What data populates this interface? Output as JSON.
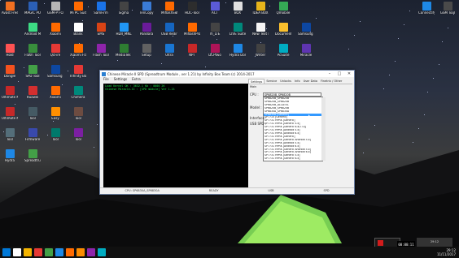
{
  "desktop": {
    "icons": [
      {
        "label": "Avast Free Antivirus",
        "color": "#f37021"
      },
      {
        "label": "MAGIC POK",
        "color": "#2b5fb5"
      },
      {
        "label": "GSM-P FOA",
        "color": "#b6b6b6"
      },
      {
        "label": "Mi PC Suite",
        "color": "#ff6a00"
      },
      {
        "label": "SamFirm",
        "color": "#1a73e8"
      },
      {
        "label": "Sigma",
        "color": "#444444"
      },
      {
        "label": "TenCopy",
        "color": "#3a7bd5"
      },
      {
        "label": "MiflashSetup",
        "color": "#ff6a00"
      },
      {
        "label": "HDC-Tool",
        "color": "#2d2d2d"
      },
      {
        "label": "ACT",
        "color": "#5b5bd6"
      },
      {
        "label": "BOX",
        "color": "#e0e0e0"
      },
      {
        "label": "IDEA BOX",
        "color": "#e7b41b"
      },
      {
        "label": "Qmobile",
        "color": "#35a855"
      },
      {
        "label": "GSM Tool",
        "color": "#4a4a4a"
      },
      {
        "label": "Connectify Hotspot",
        "color": "#1e88e5"
      },
      {
        "label": "Android MTK",
        "color": "#3ddc84"
      },
      {
        "label": "Xiaomi",
        "color": "#ff6a00"
      },
      {
        "label": "Blank",
        "color": "#ffffff"
      },
      {
        "label": "EMS",
        "color": "#d84315"
      },
      {
        "label": "HDII_MNL",
        "color": "#2196f3"
      },
      {
        "label": "Pandora",
        "color": "#6a1b9a"
      },
      {
        "label": "USB Redirect",
        "color": "#1565c0"
      },
      {
        "label": "MiflashPro",
        "color": "#ff6a00"
      },
      {
        "label": "rh_LTE",
        "color": "#444444"
      },
      {
        "label": "LIVE Suite",
        "color": "#00897b"
      },
      {
        "label": "New Text Document",
        "color": "#f5f5f5"
      },
      {
        "label": "Documents",
        "color": "#fbc02d"
      },
      {
        "label": "Samsung Tool",
        "color": "#0d47a1"
      },
      {
        "label": "Hold",
        "color": "#ff5252"
      },
      {
        "label": "Flash Tool",
        "color": "#388e3c"
      },
      {
        "label": "QcFire",
        "color": "#e53935"
      },
      {
        "label": "Xiaomi Flash",
        "color": "#ff6a00"
      },
      {
        "label": "Flash Tool",
        "color": "#8e24aa"
      },
      {
        "label": "MediaTek SP",
        "color": "#2e7d32"
      },
      {
        "label": "Setup",
        "color": "#616161"
      },
      {
        "label": "Ultra",
        "color": "#1976d2"
      },
      {
        "label": "NPT",
        "color": "#c62828"
      },
      {
        "label": "DCPtwo",
        "color": "#ad1457"
      },
      {
        "label": "Hydra Dongle",
        "color": "#1e88e5"
      },
      {
        "label": "Writer",
        "color": "#424242"
      },
      {
        "label": "PcSuite",
        "color": "#00acc1"
      },
      {
        "label": "Miracle",
        "color": "#5e35b1"
      },
      {
        "label": "Dongle",
        "color": "#f4511e"
      },
      {
        "label": "SPD Tool",
        "color": "#43a047"
      },
      {
        "label": "Samsung Tool",
        "color": "#0d47a1"
      },
      {
        "label": "Infinity Box",
        "color": "#e53935"
      },
      {
        "label": "Ultimate Multi Tool",
        "color": "#c62828"
      },
      {
        "label": "Huawei",
        "color": "#d32f2f"
      },
      {
        "label": "Xiaomi",
        "color": "#ff6a00"
      },
      {
        "label": "Chimera",
        "color": "#00897b"
      },
      {
        "label": "Ultimate Multi Tool",
        "color": "#c62828"
      },
      {
        "label": "Tool",
        "color": "#455a64"
      },
      {
        "label": "Easy",
        "color": "#ff8f00"
      },
      {
        "label": "Tool",
        "color": "#6d4c41"
      },
      {
        "label": "Tool",
        "color": "#546e7a"
      },
      {
        "label": "Firmware",
        "color": "#3949ab"
      },
      {
        "label": "Tool",
        "color": "#00796b"
      },
      {
        "label": "Tool",
        "color": "#7b1fa2"
      },
      {
        "label": "Hydra",
        "color": "#1e88e5"
      },
      {
        "label": "Spreadtrum",
        "color": "#43a047"
      }
    ]
  },
  "window": {
    "title": "Chinese Miracle II SPD (Spreadtrum Module , ver 1.21) by Infinity Box Team (c) 2014-2017",
    "minimize": "–",
    "maximize": "□",
    "close": "✕",
    "menu": [
      "File",
      "Settings",
      "Extra"
    ],
    "console_lines": [
      "Load Kernel OK : 3632.1 Kb ; 0000 2K",
      "Chinese Miracle-II : [SPD module] Ver 1.21"
    ],
    "tabs": [
      "Settings",
      "Service",
      "Unlocks",
      "Info",
      "User Data",
      "Finetrix / Other"
    ],
    "subtab": "Main",
    "cpu_label": "CPU :",
    "cpu_value": "SP6820B_SP6820B",
    "model_label": "Model :",
    "interface_label": "Interface :",
    "usb_label": "USB SPD :",
    "cpu_options": [
      "SP6820B_SP6820B",
      "SP6820B_SP6820B",
      "SP6820B_ALCATEL",
      "SP6820B_SP6820B",
      "SP6830A_SP6830A",
      "SP6830A [Generic]",
      "SP7715 [Generic]",
      "SP7731 HPRK [Generic]",
      "SP7731 HPRK [Generic 5.x]",
      "SP7731 HPRK [Generic 6.x(7.0)]",
      "SP7731 HPRK [Android 5.x]",
      "SP7731 HPRK [Android 6.x]",
      "SP7731 HPRK [Generic]",
      "SP7731 HPRK [Generic Android 5.x]",
      "SP7731 HPRK [Android 5.x]",
      "SP7731 HPRK [Android 6.x]",
      "SP7731 HPRK [Generic Android 5.x]",
      "SP7731 HPRK [Generic Android 6.x]",
      "SP7731 HPRK [Generic 5.x]",
      "SP7731 HPRK [Generic 6.x]"
    ],
    "selected_option_index": 5,
    "status": [
      "CPU: SP6830A_SP6830A",
      "READY",
      "USB",
      "SPD"
    ]
  },
  "overlay": {
    "timer": "00:00:11",
    "clock": "29:12"
  },
  "taskbar": {
    "apps_colors": [
      "#0078d7",
      "#ffffff",
      "#f4b400",
      "#e53935",
      "#43a047",
      "#1e88e5",
      "#ff6a00",
      "#fb8c00",
      "#8e24aa",
      "#00acc1"
    ],
    "time": "29:12",
    "date": "11/11/2017"
  }
}
